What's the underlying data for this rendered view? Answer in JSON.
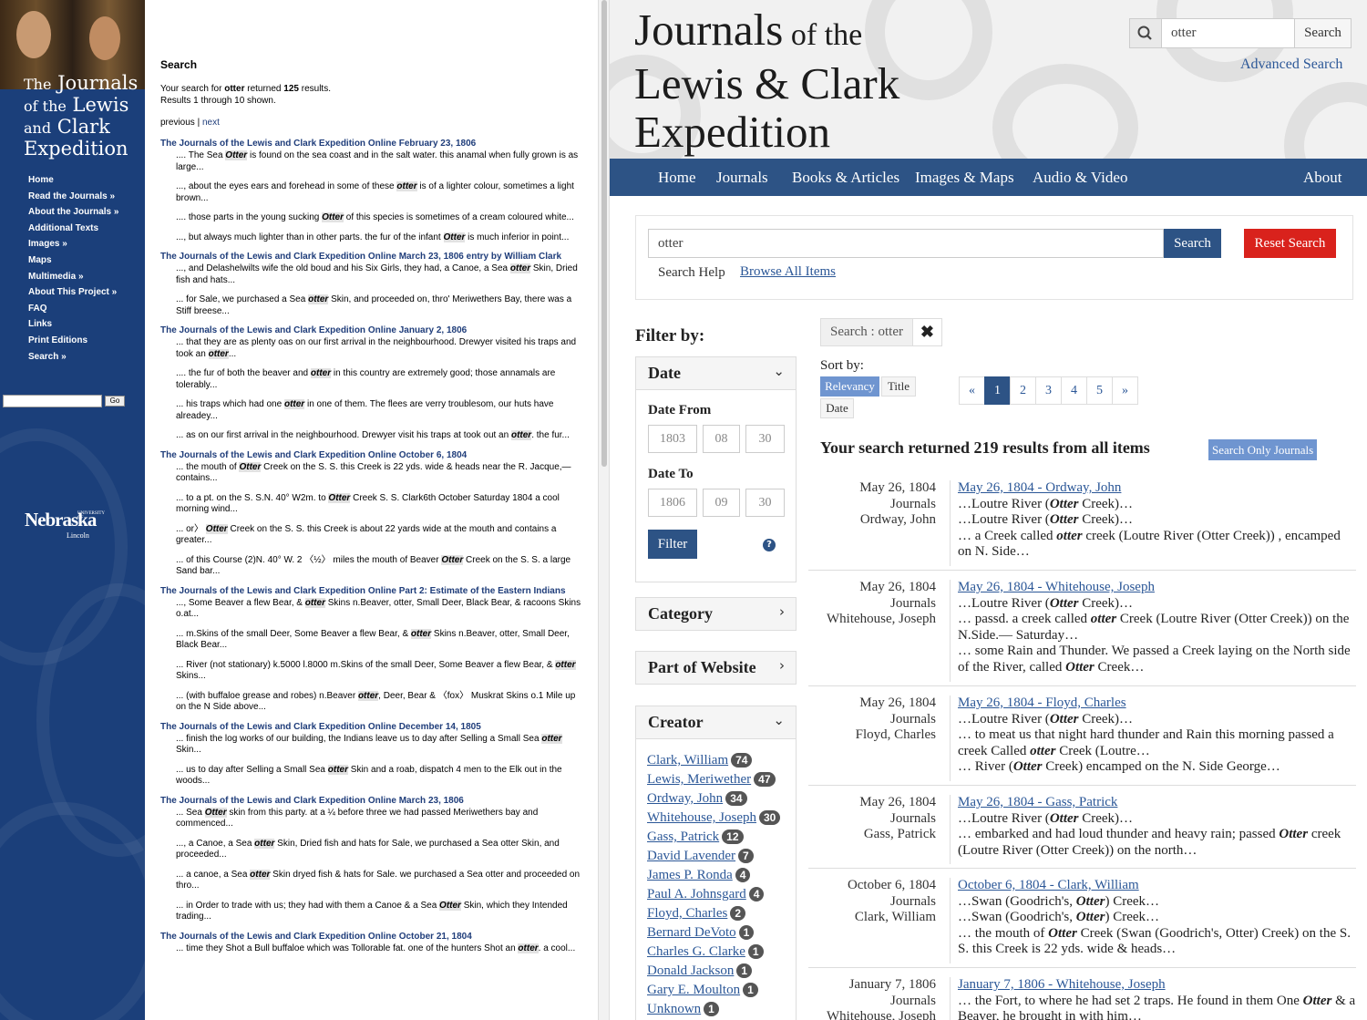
{
  "old_site": {
    "title_the": "The",
    "title_journals": "Journals",
    "title_of_the": "of the",
    "title_lewis": "Lewis",
    "title_and": "and",
    "title_clark": "Clark",
    "title_expedition": "Expedition",
    "nav": [
      "Home",
      "Read the Journals »",
      "About the Journals »",
      "Additional Texts",
      "Images »",
      "Maps",
      "Multimedia »",
      "About This Project »",
      "FAQ",
      "Links",
      "Print Editions",
      "Search »"
    ],
    "search_button": "Go",
    "nebraska_label": "Nebraska",
    "nebraska_sup": "UNIVERSITY OF",
    "nebraska_city": "Lincoln",
    "heading": "Search",
    "summary_pre": "Your search for ",
    "summary_term": "otter",
    "summary_mid": " returned ",
    "summary_count": "125",
    "summary_post": " results.",
    "summary_line2": "Results 1 through 10 shown.",
    "pager_prev": "previous",
    "pager_sep": " | ",
    "pager_next": "next",
    "results": [
      {
        "title": "The Journals of the Lewis and Clark Expedition Online February 23, 1806",
        "snippets": [
          [
            ".... The Sea ",
            "Otter",
            " is found on the sea coast and in the salt water.     this anamal when fully grown is as large..."
          ],
          [
            "..., about the eyes ears and forehead in some of these ",
            "otter",
            " is of a lighter colour, sometimes a light brown..."
          ],
          [
            "....     those parts in the young sucking ",
            "Otter",
            " of this species is sometimes of a cream coloured white..."
          ],
          [
            "..., but always much lighter than in other parts.     the fur of the infant ",
            "Otter",
            " is much inferior in point..."
          ]
        ]
      },
      {
        "title": "The Journals of the Lewis and Clark Expedition Online March 23, 1806 entry by William Clark",
        "snippets": [
          [
            "..., and Delashelwilts wife the old boud and his Six Girls, they had, a Canoe, a Sea ",
            "otter",
            " Skin, Dried fish and hats..."
          ],
          [
            "... for Sale, we purchased a Sea ",
            "otter",
            " Skin, and proceeded on, thro' Meriwethers Bay, there was a Stiff breese..."
          ]
        ]
      },
      {
        "title": "The Journals of the Lewis and Clark Expedition Online January 2, 1806",
        "snippets": [
          [
            "... that they are as plenty oas on our first arrival in the neighbourhood. Drewyer visited his traps and took an ",
            "otter",
            "..."
          ],
          [
            "....     the fur of both the beaver and ",
            "otter",
            " in this country are extremely good; those annamals are tolerably..."
          ],
          [
            "... his traps which had one ",
            "otter",
            " in one of them. The flees are verry troublesom, our huts have alreadey..."
          ],
          [
            "... as on our first arrival in the neighbourhood. Drewyer visit his traps at took out an ",
            "otter",
            ".     the fur..."
          ]
        ]
      },
      {
        "title": "The Journals of the Lewis and Clark Expedition Online October 6, 1804",
        "snippets": [
          [
            "... the mouth of ",
            "Otter",
            " Creek on the S. S. this Creek is 22 yds. wide & heads near the R. Jacque,—     contains..."
          ],
          [
            "... to a pt. on the S. S.N. 40° W2m. to ",
            "Otter",
            " Creek S. S. Clark6th October Saturday 1804 a cool morning wind..."
          ],
          [
            "... or〉  ",
            "Otter",
            " Creek on the S. S.     this Creek is about 22 yards wide at the mouth and contains a greater..."
          ],
          [
            "... of this Course (2)N. 40° W.  2 〈½〉 miles the mouth of Beaver ",
            "Otter",
            " Creek on the S. S. a large Sand bar..."
          ]
        ]
      },
      {
        "title": "The Journals of the Lewis and Clark Expedition Online Part 2: Estimate of the Eastern Indians",
        "snippets": [
          [
            "..., Some Beaver a flew Bear, & ",
            "otter",
            " Skins n.Beaver, otter, Small Deer, Black Bear, & racoons Skins o.at..."
          ],
          [
            "... m.Skins of the small Deer, Some Beaver a flew Bear, & ",
            "otter",
            " Skins n.Beaver, otter, Small Deer, Black Bear..."
          ],
          [
            "... River (not stationary) k.5000 l.8000 m.Skins of the small Deer, Some Beaver a flew Bear, & ",
            "otter",
            " Skins..."
          ],
          [
            "... (with buffaloe grease and robes) n.Beaver ",
            "otter",
            ", Deer, Bear & 〈fox〉 Muskrat Skins o.1 Mile up on the N Side above..."
          ]
        ]
      },
      {
        "title": "The Journals of the Lewis and Clark Expedition Online December 14, 1805",
        "snippets": [
          [
            "... finish the log works of our building, the Indians leave us to day after Selling a Small Sea ",
            "otter",
            " Skin..."
          ],
          [
            "... us to day after Selling a Small Sea ",
            "otter",
            " Skin and a roab, dispatch 4 men to the Elk out in the woods..."
          ]
        ]
      },
      {
        "title": "The Journals of the Lewis and Clark Expedition Online March 23, 1806",
        "snippets": [
          [
            "... Sea ",
            "Otter",
            " skin from this party.   at a ¼ before three we had passed Meriwethers bay and commenced..."
          ],
          [
            "..., a Canoe, a Sea ",
            "otter",
            " Skin, Dried fish and hats for Sale, we purchased a Sea otter Skin, and proceeded..."
          ],
          [
            "... a canoe, a Sea ",
            "otter",
            " Skin dryed fish & hats for Sale.     we purchased a Sea otter and proceeded on thro..."
          ],
          [
            "... in Order to trade with us; they had with them a Canoe & a Sea ",
            "Otter",
            " Skin, which they Intended trading..."
          ]
        ]
      },
      {
        "title": "The Journals of the Lewis and Clark Expedition Online October 21, 1804",
        "snippets": [
          [
            "... time they Shot a Bull buffaloe which was Tollorable fat.     one of the hunters Shot an ",
            "otter",
            ".     a cool..."
          ]
        ]
      }
    ]
  },
  "new_site": {
    "title_line1_a": "Journals",
    "title_line1_b": " of the",
    "title_line2": "Lewis & Clark",
    "title_line3": "Expedition",
    "top_search_value": "otter",
    "top_search_button": "Search",
    "advanced_search": "Advanced Search",
    "nav": [
      "Home",
      "Journals",
      "Books & Articles",
      "Images & Maps",
      "Audio & Video",
      "About"
    ],
    "search_value": "otter",
    "search_button": "Search",
    "reset_button": "Reset Search",
    "search_help": "Search Help",
    "browse_all": "Browse All Items",
    "filter_by": "Filter by:",
    "facets": {
      "date": "Date",
      "date_from": "Date From",
      "date_from_values": [
        "1803",
        "08",
        "30"
      ],
      "date_to": "Date To",
      "date_to_values": [
        "1806",
        "09",
        "30"
      ],
      "filter_button": "Filter",
      "help_icon": "?",
      "category": "Category",
      "part_of_website": "Part of Website",
      "creator": "Creator"
    },
    "creators": [
      {
        "name": "Clark, William",
        "count": "74"
      },
      {
        "name": "Lewis, Meriwether",
        "count": "47"
      },
      {
        "name": "Ordway, John",
        "count": "34"
      },
      {
        "name": "Whitehouse, Joseph",
        "count": "30"
      },
      {
        "name": "Gass, Patrick",
        "count": "12"
      },
      {
        "name": "David Lavender",
        "count": "7"
      },
      {
        "name": "James P. Ronda",
        "count": "4"
      },
      {
        "name": "Paul A. Johnsgard",
        "count": "4"
      },
      {
        "name": "Floyd, Charles",
        "count": "2"
      },
      {
        "name": "Bernard DeVoto",
        "count": "1"
      },
      {
        "name": "Charles G. Clarke",
        "count": "1"
      },
      {
        "name": "Donald Jackson",
        "count": "1"
      },
      {
        "name": "Gary E. Moulton",
        "count": "1"
      },
      {
        "name": "Unknown",
        "count": "1"
      }
    ],
    "active_filter": "Search : otter",
    "active_filter_remove": "✖",
    "sort_by": "Sort by:",
    "sort_options": [
      "Relevancy",
      "Title",
      "Date"
    ],
    "pagination": [
      "«",
      "1",
      "2",
      "3",
      "4",
      "5",
      "»"
    ],
    "result_count": "Your search returned 219 results from all items",
    "only_journals": "Search Only Journals",
    "results": [
      {
        "date": "May 26, 1804",
        "type": "Journals",
        "author": "Ordway, John",
        "title": "May 26, 1804 - Ordway, John",
        "lines": [
          [
            "…Loutre River (",
            "Otter",
            " Creek)…"
          ],
          [
            "…Loutre River (",
            "Otter",
            " Creek)…"
          ],
          [
            "… a Creek called ",
            "otter",
            " creek (Loutre River (Otter Creek)) , encamped on N. Side…"
          ]
        ]
      },
      {
        "date": "May 26, 1804",
        "type": "Journals",
        "author": "Whitehouse, Joseph",
        "title": "May 26, 1804 - Whitehouse, Joseph",
        "lines": [
          [
            "…Loutre River (",
            "Otter",
            " Creek)…"
          ],
          [
            "… passd. a creek called ",
            "otter",
            " Creek (Loutre River (Otter Creek)) on the N.Side.— Saturday…"
          ],
          [
            "… some Rain and Thunder.   We passed a Creek laying on the North side of the River, called ",
            "Otter",
            " Creek…"
          ]
        ]
      },
      {
        "date": "May 26, 1804",
        "type": "Journals",
        "author": "Floyd, Charles",
        "title": "May 26, 1804 - Floyd, Charles",
        "lines": [
          [
            "…Loutre River (",
            "Otter",
            " Creek)…"
          ],
          [
            "… to meat us that night   hard thunder and Rain this morning passed a creek Called ",
            "otter",
            " Creek (Loutre…"
          ],
          [
            "… River (",
            "Otter",
            " Creek)   encamped on the N. Side George…"
          ]
        ]
      },
      {
        "date": "May 26, 1804",
        "type": "Journals",
        "author": "Gass, Patrick",
        "title": "May 26, 1804 - Gass, Patrick",
        "lines": [
          [
            "…Loutre River (",
            "Otter",
            " Creek)…"
          ],
          [
            "… embarked and had loud thunder and heavy rain; passed ",
            "Otter",
            " creek (Loutre River (Otter Creek)) on the north…"
          ]
        ]
      },
      {
        "date": "October 6, 1804",
        "type": "Journals",
        "author": "Clark, William",
        "title": "October 6, 1804 - Clark, William",
        "lines": [
          [
            "…Swan (Goodrich's, ",
            "Otter",
            ") Creek…"
          ],
          [
            "…Swan (Goodrich's, ",
            "Otter",
            ") Creek…"
          ],
          [
            "… the mouth of ",
            "Otter",
            " Creek (Swan (Goodrich's, Otter) Creek) on the S. S. this Creek is 22 yds. wide & heads…"
          ]
        ]
      },
      {
        "date": "January 7, 1806",
        "type": "Journals",
        "author": "Whitehouse, Joseph",
        "title": "January 7, 1806 - Whitehouse, Joseph",
        "lines": [
          [
            "… the Fort, to where he had set 2 traps.   He found in them One ",
            "Otter",
            " & a Beaver, he brought in with him…"
          ]
        ]
      }
    ]
  }
}
